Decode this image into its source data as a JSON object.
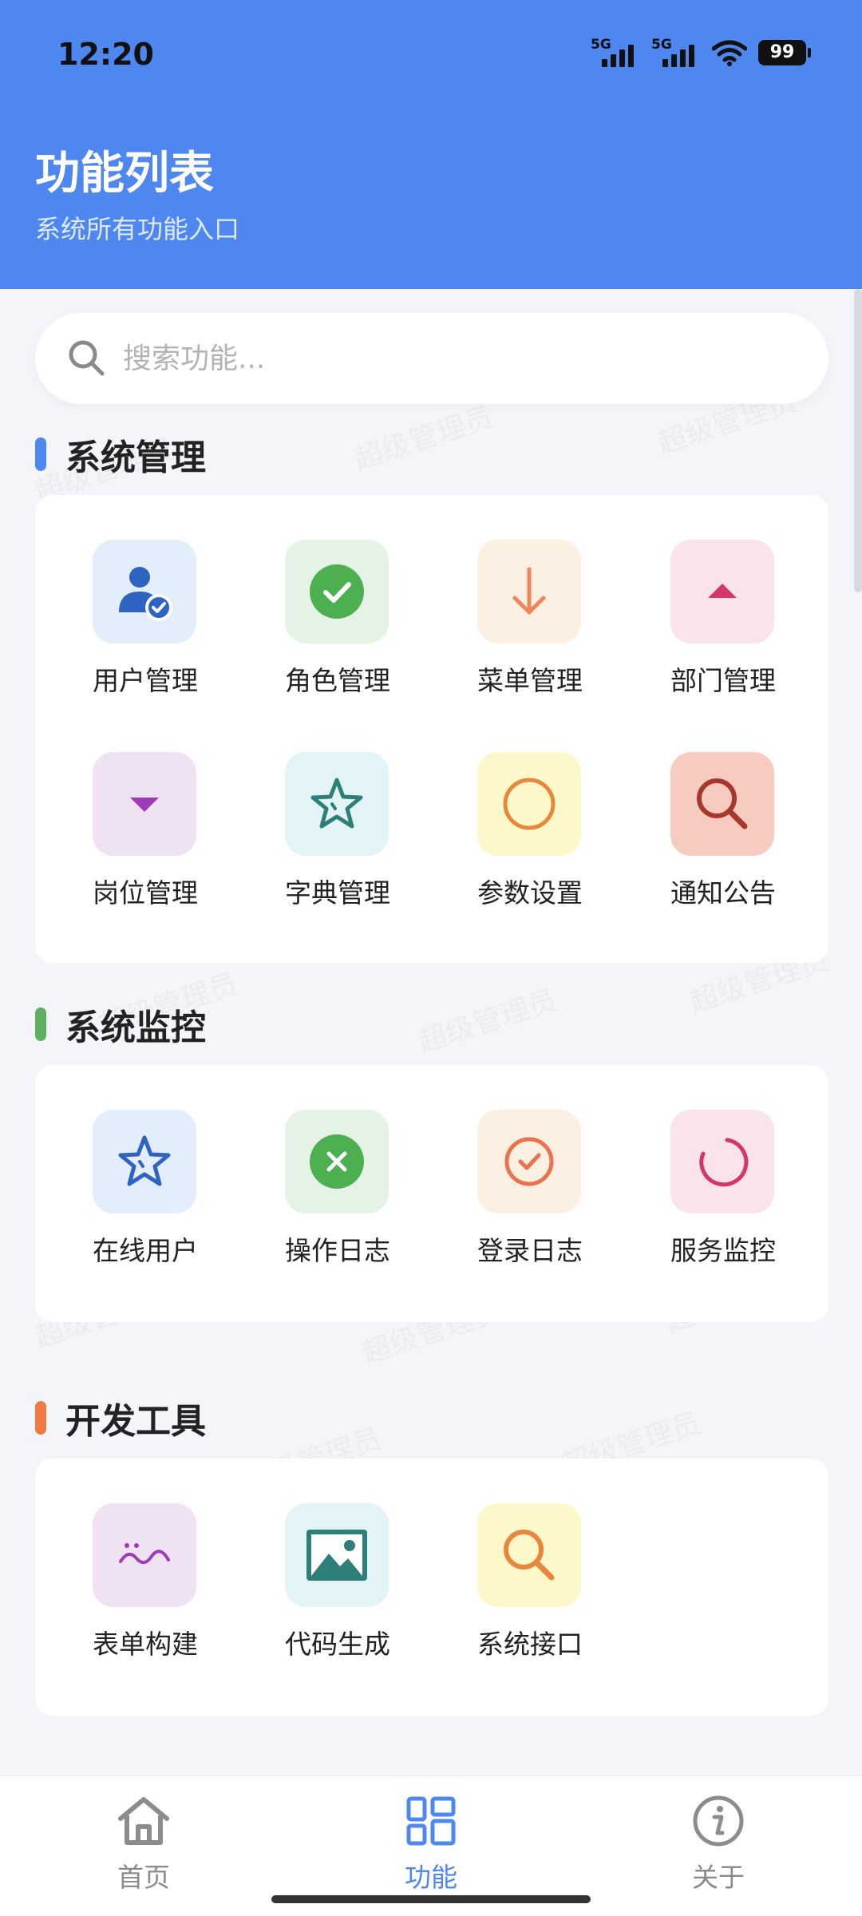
{
  "status_bar": {
    "time": "12:20",
    "network_1": "5G",
    "network_2": "5G",
    "battery": "99"
  },
  "header": {
    "title": "功能列表",
    "subtitle": "系统所有功能入口"
  },
  "search": {
    "placeholder": "搜索功能..."
  },
  "watermark_text": "超级管理员",
  "sections": [
    {
      "title": "系统管理",
      "accent": "#4e87f0",
      "items": [
        {
          "label": "用户管理",
          "icon": "user-check-icon",
          "tile_bg": "#e3eefb",
          "color": "#2f63c2"
        },
        {
          "label": "角色管理",
          "icon": "check-circle-icon",
          "tile_bg": "#e5f3e6",
          "color": "#4caf50"
        },
        {
          "label": "菜单管理",
          "icon": "arrow-down-icon",
          "tile_bg": "#fcf0e3",
          "color": "#f0855c"
        },
        {
          "label": "部门管理",
          "icon": "caret-up-icon",
          "tile_bg": "#f8e4ea",
          "color": "#d7346b"
        },
        {
          "label": "岗位管理",
          "icon": "caret-down-icon",
          "tile_bg": "#efe3f3",
          "color": "#9b3db8"
        },
        {
          "label": "字典管理",
          "icon": "star-outline-icon",
          "tile_bg": "#e2f4f5",
          "color": "#2d7f78"
        },
        {
          "label": "参数设置",
          "icon": "circle-outline-icon",
          "tile_bg": "#fdf8c9",
          "color": "#e8873a"
        },
        {
          "label": "通知公告",
          "icon": "search-icon",
          "tile_bg": "#f7cbbf",
          "color": "#a8382b"
        }
      ]
    },
    {
      "title": "系统监控",
      "accent": "#5db05e",
      "items": [
        {
          "label": "在线用户",
          "icon": "star-outline-icon",
          "tile_bg": "#e3eefb",
          "color": "#2f63c2"
        },
        {
          "label": "操作日志",
          "icon": "x-circle-icon",
          "tile_bg": "#e5f3e6",
          "color": "#4caf50"
        },
        {
          "label": "登录日志",
          "icon": "check-circle-outline-icon",
          "tile_bg": "#fcf0e3",
          "color": "#e8734d"
        },
        {
          "label": "服务监控",
          "icon": "loading-circle-icon",
          "tile_bg": "#f8e4ea",
          "color": "#d7346b"
        }
      ]
    },
    {
      "title": "开发工具",
      "accent": "#f07a43",
      "items": [
        {
          "label": "表单构建",
          "icon": "wave-icon",
          "tile_bg": "#efe3f3",
          "color": "#9b3db8"
        },
        {
          "label": "代码生成",
          "icon": "image-icon",
          "tile_bg": "#e2f4f5",
          "color": "#2d7f78"
        },
        {
          "label": "系统接口",
          "icon": "search-icon",
          "tile_bg": "#fdf8c9",
          "color": "#e8873a"
        }
      ]
    }
  ],
  "bottom_nav": [
    {
      "label": "首页",
      "icon": "home-icon",
      "active": false
    },
    {
      "label": "功能",
      "icon": "grid-icon",
      "active": true
    },
    {
      "label": "关于",
      "icon": "info-icon",
      "active": false
    }
  ],
  "colors": {
    "primary": "#4e87f0",
    "inactive_nav": "#8c8c8c"
  }
}
